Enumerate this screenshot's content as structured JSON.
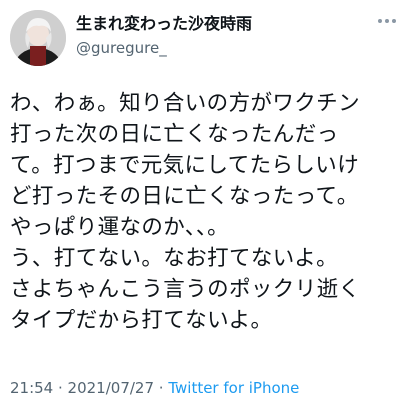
{
  "tweet": {
    "author": {
      "display_name": "生まれ変わった沙夜時雨",
      "handle": "@guregure_"
    },
    "more_icon": "more-dots-icon",
    "text_lines": [
      "わ、わぁ。知り合いの方がワクチン",
      "打った次の日に亡くなったんだっ",
      "て。打つまで元気にしてたらしいけ",
      "ど打ったその日に亡くなったって。",
      "やっぱり運なのか、、。",
      "う、打てない。なお打てないよ。",
      "さよちゃんこう言うのポックリ逝く",
      "タイプだから打てないよ。"
    ],
    "meta": {
      "time": "21:54",
      "separator1": " · ",
      "date": "2021/07/27",
      "separator2": " · ",
      "source": "Twitter for iPhone"
    }
  },
  "colors": {
    "text": "#0f1419",
    "secondary": "#536471",
    "link": "#1d9bf0",
    "background": "#ffffff"
  }
}
